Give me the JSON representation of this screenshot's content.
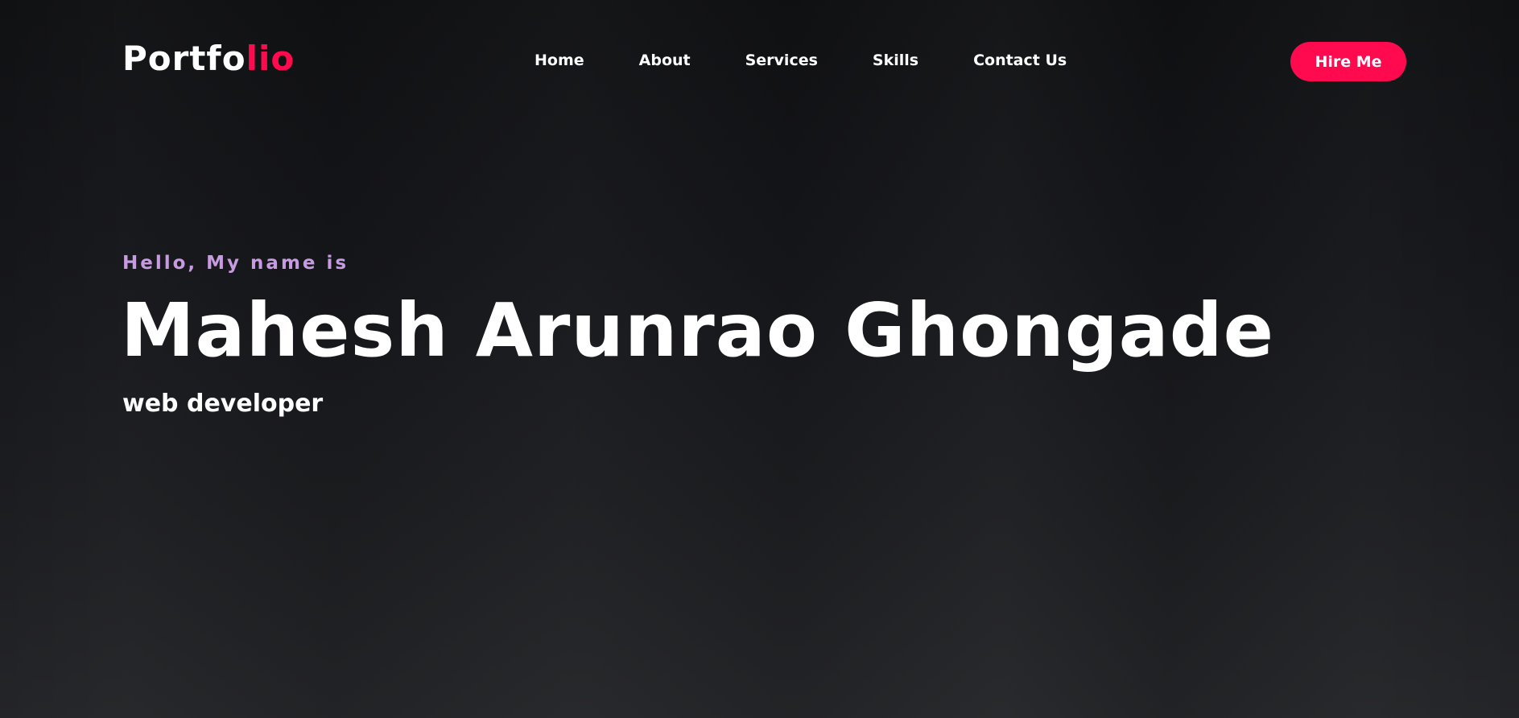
{
  "header": {
    "logo_main": "Portfo",
    "logo_accent": "lio",
    "nav": [
      {
        "label": "Home"
      },
      {
        "label": "About"
      },
      {
        "label": "Services"
      },
      {
        "label": "Skills"
      },
      {
        "label": "Contact Us"
      }
    ],
    "cta_label": "Hire Me"
  },
  "hero": {
    "greeting": "Hello, My name is",
    "name": "Mahesh Arunrao Ghongade",
    "role": "web developer"
  },
  "colors": {
    "accent": "#ff0a4f",
    "greeting": "#c79be0",
    "background": "#141517",
    "text": "#ffffff"
  }
}
